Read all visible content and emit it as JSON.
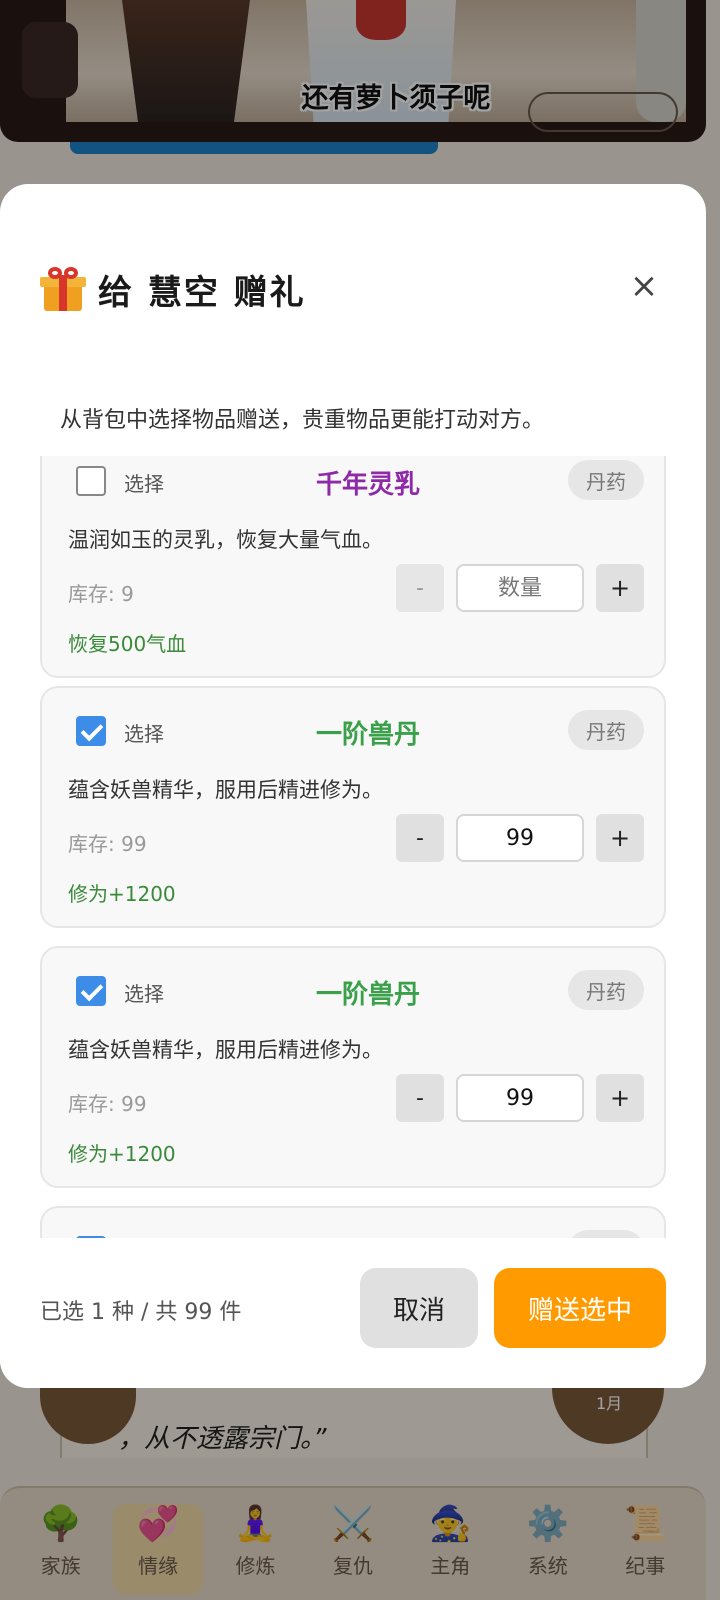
{
  "background": {
    "subtitle": "还有萝卜须子呢",
    "story_text": "，从不透露宗门。”",
    "corner_text": "1月"
  },
  "nav": {
    "items": [
      {
        "label": "家族",
        "icon": "🌳",
        "name": "family"
      },
      {
        "label": "情缘",
        "icon": "💞",
        "name": "romance"
      },
      {
        "label": "修炼",
        "icon": "🧘‍♀️",
        "name": "cultivate"
      },
      {
        "label": "复仇",
        "icon": "⚔️",
        "name": "revenge"
      },
      {
        "label": "主角",
        "icon": "🧙",
        "name": "protagonist"
      },
      {
        "label": "系统",
        "icon": "⚙️",
        "name": "system"
      },
      {
        "label": "纪事",
        "icon": "📜",
        "name": "chronicle"
      }
    ],
    "active": "情缘"
  },
  "modal": {
    "icon": "gift-icon",
    "title": "给 慧空 赠礼",
    "close_label": "×",
    "subtext": "从背包中选择物品赠送，贵重物品更能打动对方。",
    "items": [
      {
        "checked": false,
        "select_label": "选择",
        "name": "千年灵乳",
        "name_color": "#8e2aa8",
        "badge": "丹药",
        "desc": "温润如玉的灵乳，恢复大量气血。",
        "stock": "库存: 9",
        "qty_value": "",
        "qty_placeholder": "数量",
        "minus": "-",
        "plus": "+",
        "effect": "恢复500气血"
      },
      {
        "checked": true,
        "select_label": "选择",
        "name": "一阶兽丹",
        "name_color": "#3aa04a",
        "badge": "丹药",
        "desc": "蕴含妖兽精华，服用后精进修为。",
        "stock": "库存: 99",
        "qty_value": "99",
        "qty_placeholder": "数量",
        "minus": "-",
        "plus": "+",
        "effect": "修为+1200"
      },
      {
        "checked": true,
        "select_label": "选择",
        "name": "一阶兽丹",
        "name_color": "#3aa04a",
        "badge": "丹药",
        "desc": "蕴含妖兽精华，服用后精进修为。",
        "stock": "库存: 99",
        "qty_value": "99",
        "qty_placeholder": "数量",
        "minus": "-",
        "plus": "+",
        "effect": "修为+1200"
      },
      {
        "checked": true,
        "select_label": "",
        "name": "",
        "name_color": "#3aa04a",
        "badge": "",
        "desc": "",
        "stock": "",
        "qty_value": "",
        "qty_placeholder": "",
        "minus": "",
        "plus": "",
        "effect": ""
      }
    ],
    "summary": "已选 1 种 / 共 99 件",
    "cancel_label": "取消",
    "confirm_label": "赠送选中",
    "colors": {
      "confirm": "#ff9a00",
      "checkbox": "#3d8de8",
      "effect": "#3a8a3a"
    }
  }
}
